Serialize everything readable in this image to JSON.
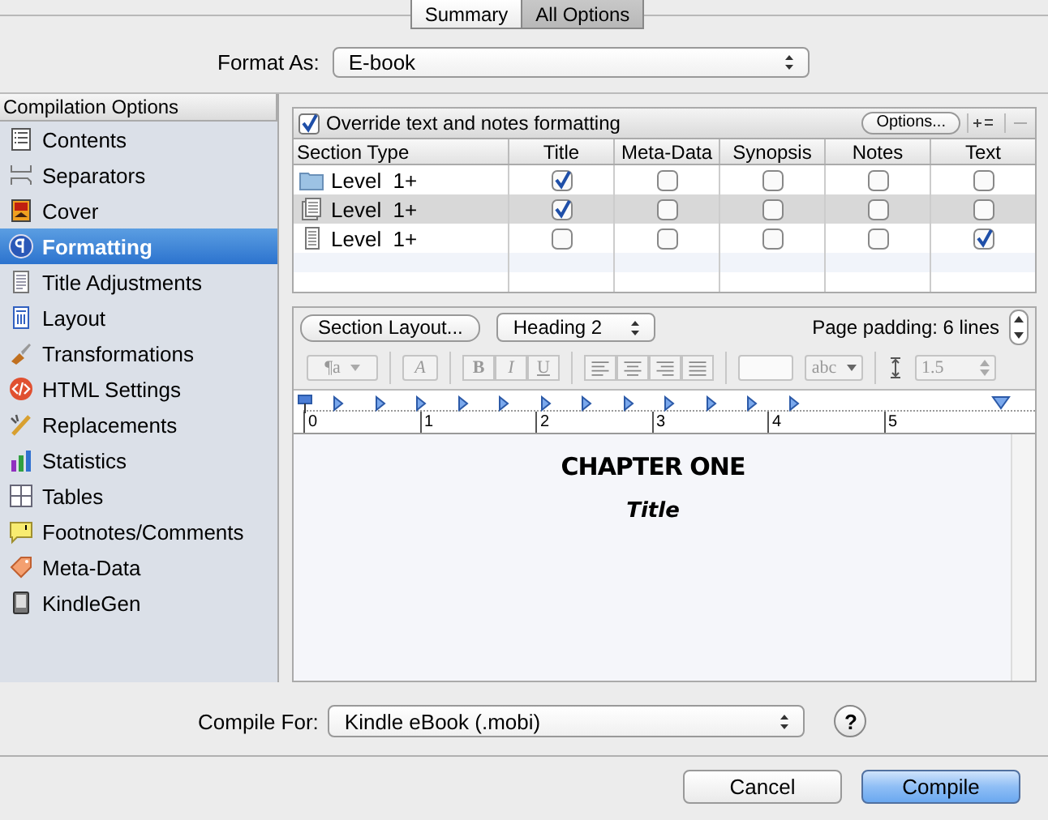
{
  "tabs": [
    {
      "label": "Summary",
      "selected": false
    },
    {
      "label": "All Options",
      "selected": true
    }
  ],
  "format_as": {
    "label": "Format As:",
    "value": "E-book"
  },
  "sidebar": {
    "title": "Compilation Options",
    "items": [
      {
        "label": "Contents",
        "kind": "list",
        "selected": false
      },
      {
        "label": "Separators",
        "kind": "separator",
        "selected": false
      },
      {
        "label": "Cover",
        "kind": "cover",
        "selected": false
      },
      {
        "label": "Formatting",
        "kind": "paragraph",
        "selected": true
      },
      {
        "label": "Title Adjustments",
        "kind": "page",
        "selected": false
      },
      {
        "label": "Layout",
        "kind": "layout",
        "selected": false
      },
      {
        "label": "Transformations",
        "kind": "brush",
        "selected": false
      },
      {
        "label": "HTML Settings",
        "kind": "html",
        "selected": false
      },
      {
        "label": "Replacements",
        "kind": "wand",
        "selected": false
      },
      {
        "label": "Statistics",
        "kind": "bars",
        "selected": false
      },
      {
        "label": "Tables",
        "kind": "grid",
        "selected": false
      },
      {
        "label": "Footnotes/Comments",
        "kind": "note",
        "selected": false
      },
      {
        "label": "Meta-Data",
        "kind": "tag",
        "selected": false
      },
      {
        "label": "KindleGen",
        "kind": "device",
        "selected": false
      }
    ]
  },
  "override": {
    "label": "Override text and notes formatting",
    "checked": true
  },
  "options_button": "Options...",
  "table": {
    "columns": [
      "Section Type",
      "Title",
      "Meta-Data",
      "Synopsis",
      "Notes",
      "Text"
    ],
    "rows": [
      {
        "kind": "folder",
        "label": "Level  1+",
        "selected": false,
        "checks": [
          true,
          false,
          false,
          false,
          false
        ]
      },
      {
        "kind": "stack",
        "label": "Level  1+",
        "selected": true,
        "checks": [
          true,
          false,
          false,
          false,
          false
        ]
      },
      {
        "kind": "doc",
        "label": "Level  1+",
        "selected": false,
        "checks": [
          false,
          false,
          false,
          false,
          true
        ]
      }
    ]
  },
  "editor": {
    "section_layout": "Section Layout...",
    "style": "Heading 2",
    "page_padding": "Page padding: 6 lines",
    "paragraph_style": "¶a",
    "font_button": "A",
    "bold": "B",
    "italic": "I",
    "underline": "U",
    "highlight": "abc",
    "line_spacing": "1.5",
    "ruler": [
      "0",
      "1",
      "2",
      "3",
      "4",
      "5"
    ],
    "heading": "CHAPTER ONE",
    "title": "Title"
  },
  "compile_for": {
    "label": "Compile For:",
    "value": "Kindle eBook (.mobi)",
    "help": "?"
  },
  "buttons": [
    {
      "label": "Cancel",
      "kind": "cancel"
    },
    {
      "label": "Compile",
      "kind": "default"
    }
  ]
}
